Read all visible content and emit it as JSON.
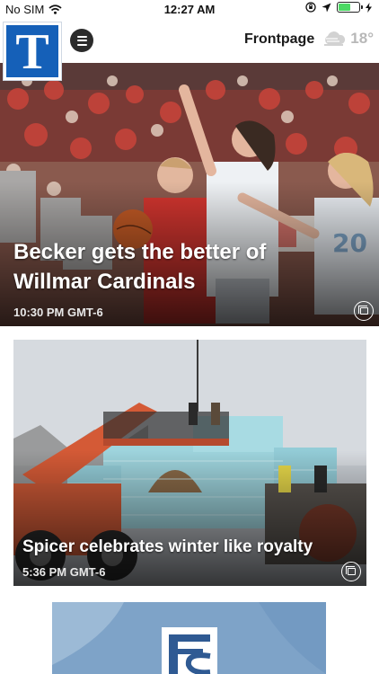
{
  "status_bar": {
    "carrier": "No SIM",
    "time": "12:27 AM",
    "battery_level": 0.6
  },
  "header": {
    "logo_letter": "T",
    "section_title": "Frontpage",
    "weather_temp": "18°",
    "weather_icon": "cloud-icon"
  },
  "stories": [
    {
      "headline": "Becker gets the better of Willmar Cardinals",
      "timestamp": "10:30 PM GMT-6",
      "icon": "gallery-icon"
    },
    {
      "headline": "Spicer celebrates winter like royalty",
      "timestamp": "5:36 PM GMT-6",
      "icon": "gallery-icon"
    }
  ],
  "colors": {
    "brand_blue": "#1560b8",
    "ad_blue": "#7ea3c8",
    "battery_green": "#4cd964"
  }
}
